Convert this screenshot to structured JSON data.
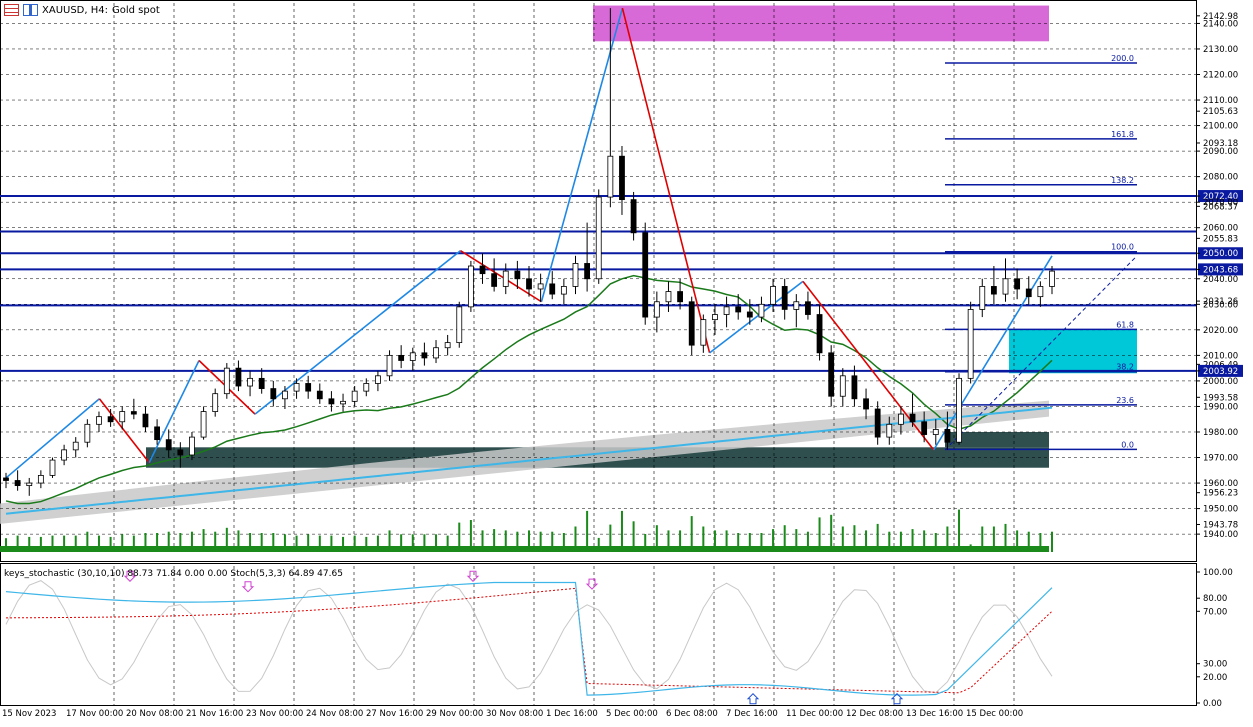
{
  "header": {
    "symbol": "XAUUSD, H4:",
    "description": "Gold spot"
  },
  "indicator_label": "keys_stochastic (30,10,10) 88.73 71.84 0.00 0.00 Stoch(5,3,3) 64.89 47.65",
  "colors": {
    "bull": "#ffffff",
    "bear": "#000000",
    "grid": "#000000",
    "hline": "#0a1aa0",
    "zigzag_up": "#1e88e5",
    "zigzag_down": "#e00000",
    "ma_green": "#1a7a1a",
    "ma_blue": "#3fb6e8",
    "cloud": "#c8c8c8",
    "pink_zone": "#d86ad8",
    "dark_zone": "#2f4f4f",
    "cyan_zone": "#00c8d8",
    "volume": "#1a8a1a"
  },
  "chart_data": {
    "type": "candlestick",
    "x_ticks": [
      "15 Nov 2023",
      "17 Nov 00:00",
      "20 Nov 08:00",
      "21 Nov 16:00",
      "23 Nov 00:00",
      "24 Nov 08:00",
      "27 Nov 16:00",
      "29 Nov 00:00",
      "30 Nov 08:00",
      "1 Dec 16:00",
      "5 Dec 00:00",
      "6 Dec 08:00",
      "7 Dec 16:00",
      "11 Dec 00:00",
      "12 Dec 08:00",
      "13 Dec 16:00",
      "15 Dec 00:00"
    ],
    "price_ticks": [
      "2142.98",
      "2140.00",
      "2130.00",
      "2120.00",
      "2110.00",
      "2105.63",
      "2100.00",
      "2093.18",
      "2090.00",
      "2080.00",
      "2072.40",
      "2070.00",
      "2068.37",
      "2060.00",
      "2055.83",
      "2050.00",
      "2043.68",
      "2040.00",
      "2031.26",
      "2030.00",
      "2020.00",
      "2010.00",
      "2006.49",
      "2003.92",
      "2000.00",
      "1993.58",
      "1990.00",
      "1980.00",
      "1970.00",
      "1960.00",
      "1956.23",
      "1950.00",
      "1943.78",
      "1940.00"
    ],
    "price_range": [
      1933,
      2148
    ],
    "osc_ticks": [
      "100.00",
      "80.00",
      "70.00",
      "30.00",
      "20.00",
      "0.00"
    ],
    "osc_range": [
      0,
      100
    ],
    "horizontal_levels": [
      2072.4,
      2058.5,
      2050.0,
      2043.68,
      2029.6,
      2003.92
    ],
    "fib_levels": [
      {
        "label": "200.0",
        "price": 2124.5
      },
      {
        "label": "161.8",
        "price": 2094.8
      },
      {
        "label": "138.2",
        "price": 2076.8
      },
      {
        "label": "100.0",
        "price": 2050.6
      },
      {
        "label": "61.8",
        "price": 2020.2
      },
      {
        "label": "38.2",
        "price": 2003.6
      },
      {
        "label": "23.6",
        "price": 1990.6
      },
      {
        "label": "0.0",
        "price": 1973.2
      }
    ],
    "candles": [
      [
        1962,
        1964,
        1958,
        1961
      ],
      [
        1961,
        1965,
        1957,
        1959
      ],
      [
        1959,
        1962,
        1955,
        1960
      ],
      [
        1960,
        1965,
        1958,
        1963
      ],
      [
        1963,
        1970,
        1962,
        1969
      ],
      [
        1969,
        1975,
        1967,
        1973
      ],
      [
        1973,
        1978,
        1970,
        1976
      ],
      [
        1976,
        1985,
        1974,
        1983
      ],
      [
        1983,
        1988,
        1980,
        1986
      ],
      [
        1986,
        1989,
        1982,
        1984
      ],
      [
        1984,
        1990,
        1981,
        1988
      ],
      [
        1988,
        1993,
        1985,
        1987
      ],
      [
        1987,
        1990,
        1980,
        1982
      ],
      [
        1982,
        1985,
        1975,
        1977
      ],
      [
        1977,
        1981,
        1970,
        1973
      ],
      [
        1973,
        1976,
        1966,
        1971
      ],
      [
        1971,
        1980,
        1969,
        1978
      ],
      [
        1978,
        1990,
        1977,
        1988
      ],
      [
        1988,
        1997,
        1986,
        1995
      ],
      [
        1995,
        2007,
        1993,
        2005
      ],
      [
        2005,
        2008,
        1996,
        1998
      ],
      [
        1998,
        2004,
        1994,
        2001
      ],
      [
        2001,
        2005,
        1995,
        1997
      ],
      [
        1997,
        2000,
        1990,
        1993
      ],
      [
        1993,
        1998,
        1989,
        1996
      ],
      [
        1996,
        2001,
        1993,
        1999
      ],
      [
        1999,
        2002,
        1993,
        1996
      ],
      [
        1996,
        1999,
        1991,
        1993
      ],
      [
        1993,
        1996,
        1988,
        1991
      ],
      [
        1991,
        1995,
        1988,
        1992
      ],
      [
        1992,
        1998,
        1990,
        1996
      ],
      [
        1996,
        2001,
        1994,
        1999
      ],
      [
        1999,
        2004,
        1996,
        2002
      ],
      [
        2002,
        2012,
        2000,
        2010
      ],
      [
        2010,
        2014,
        2005,
        2008
      ],
      [
        2008,
        2013,
        2004,
        2011
      ],
      [
        2011,
        2015,
        2006,
        2009
      ],
      [
        2009,
        2016,
        2007,
        2013
      ],
      [
        2013,
        2018,
        2010,
        2015
      ],
      [
        2015,
        2031,
        2013,
        2029
      ],
      [
        2029,
        2047,
        2027,
        2045
      ],
      [
        2045,
        2050,
        2038,
        2042
      ],
      [
        2042,
        2048,
        2035,
        2037
      ],
      [
        2037,
        2046,
        2034,
        2043
      ],
      [
        2043,
        2047,
        2036,
        2040
      ],
      [
        2040,
        2045,
        2033,
        2036
      ],
      [
        2036,
        2042,
        2031,
        2038
      ],
      [
        2038,
        2043,
        2032,
        2034
      ],
      [
        2034,
        2040,
        2030,
        2037
      ],
      [
        2037,
        2049,
        2034,
        2046
      ],
      [
        2046,
        2062,
        2035,
        2040
      ],
      [
        2040,
        2075,
        2038,
        2072
      ],
      [
        2072,
        2146,
        2068,
        2088
      ],
      [
        2088,
        2092,
        2065,
        2071
      ],
      [
        2071,
        2074,
        2055,
        2058
      ],
      [
        2058,
        2062,
        2022,
        2025
      ],
      [
        2025,
        2035,
        2019,
        2031
      ],
      [
        2031,
        2039,
        2027,
        2035
      ],
      [
        2035,
        2040,
        2028,
        2031
      ],
      [
        2031,
        2033,
        2010,
        2014
      ],
      [
        2014,
        2026,
        2011,
        2024
      ],
      [
        2024,
        2030,
        2018,
        2026
      ],
      [
        2026,
        2033,
        2021,
        2029
      ],
      [
        2029,
        2034,
        2024,
        2027
      ],
      [
        2027,
        2032,
        2022,
        2025
      ],
      [
        2025,
        2033,
        2023,
        2030
      ],
      [
        2030,
        2040,
        2027,
        2037
      ],
      [
        2037,
        2040,
        2024,
        2028
      ],
      [
        2028,
        2034,
        2021,
        2031
      ],
      [
        2031,
        2035,
        2024,
        2026
      ],
      [
        2026,
        2030,
        2008,
        2011
      ],
      [
        2011,
        2014,
        1990,
        1994
      ],
      [
        1994,
        2005,
        1990,
        2002
      ],
      [
        2002,
        2006,
        1990,
        1993
      ],
      [
        1993,
        1997,
        1985,
        1989
      ],
      [
        1989,
        1992,
        1975,
        1978
      ],
      [
        1978,
        1986,
        1975,
        1983
      ],
      [
        1983,
        1990,
        1979,
        1987
      ],
      [
        1987,
        1995,
        1982,
        1984
      ],
      [
        1984,
        1988,
        1976,
        1979
      ],
      [
        1979,
        1985,
        1975,
        1981
      ],
      [
        1981,
        1988,
        1973,
        1976
      ],
      [
        1976,
        2003,
        1975,
        2001
      ],
      [
        2001,
        2031,
        1999,
        2028
      ],
      [
        2028,
        2040,
        2025,
        2037
      ],
      [
        2037,
        2045,
        2030,
        2034
      ],
      [
        2034,
        2048,
        2031,
        2040
      ],
      [
        2040,
        2044,
        2032,
        2036
      ],
      [
        2036,
        2041,
        2030,
        2033
      ],
      [
        2033,
        2039,
        2029,
        2037
      ],
      [
        2037,
        2045,
        2034,
        2043
      ]
    ]
  }
}
